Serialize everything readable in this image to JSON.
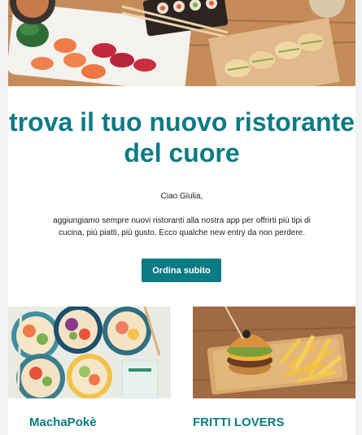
{
  "hero": {
    "image_name": "sushi-and-dumplings-photo"
  },
  "headline": "trova il tuo nuovo ristorante del cuore",
  "greeting": "Ciao Giulia,",
  "body": "aggiungiamo sempre nuovi ristoranti alla nostra app per offrirti più tipi di cucina, più piatti, più gusto. Ecco qualche new entry da non perdere.",
  "cta": {
    "label": "Ordina subito",
    "color": "#0c7b84"
  },
  "restaurants": [
    {
      "name": "MachaPokè",
      "image_name": "poke-bowls-photo"
    },
    {
      "name": "FRITTI LOVERS",
      "image_name": "burger-and-fries-photo"
    }
  ],
  "colors": {
    "accent": "#0c7b84",
    "page_bg": "#f1f3f3",
    "card_bg": "#ffffff"
  }
}
